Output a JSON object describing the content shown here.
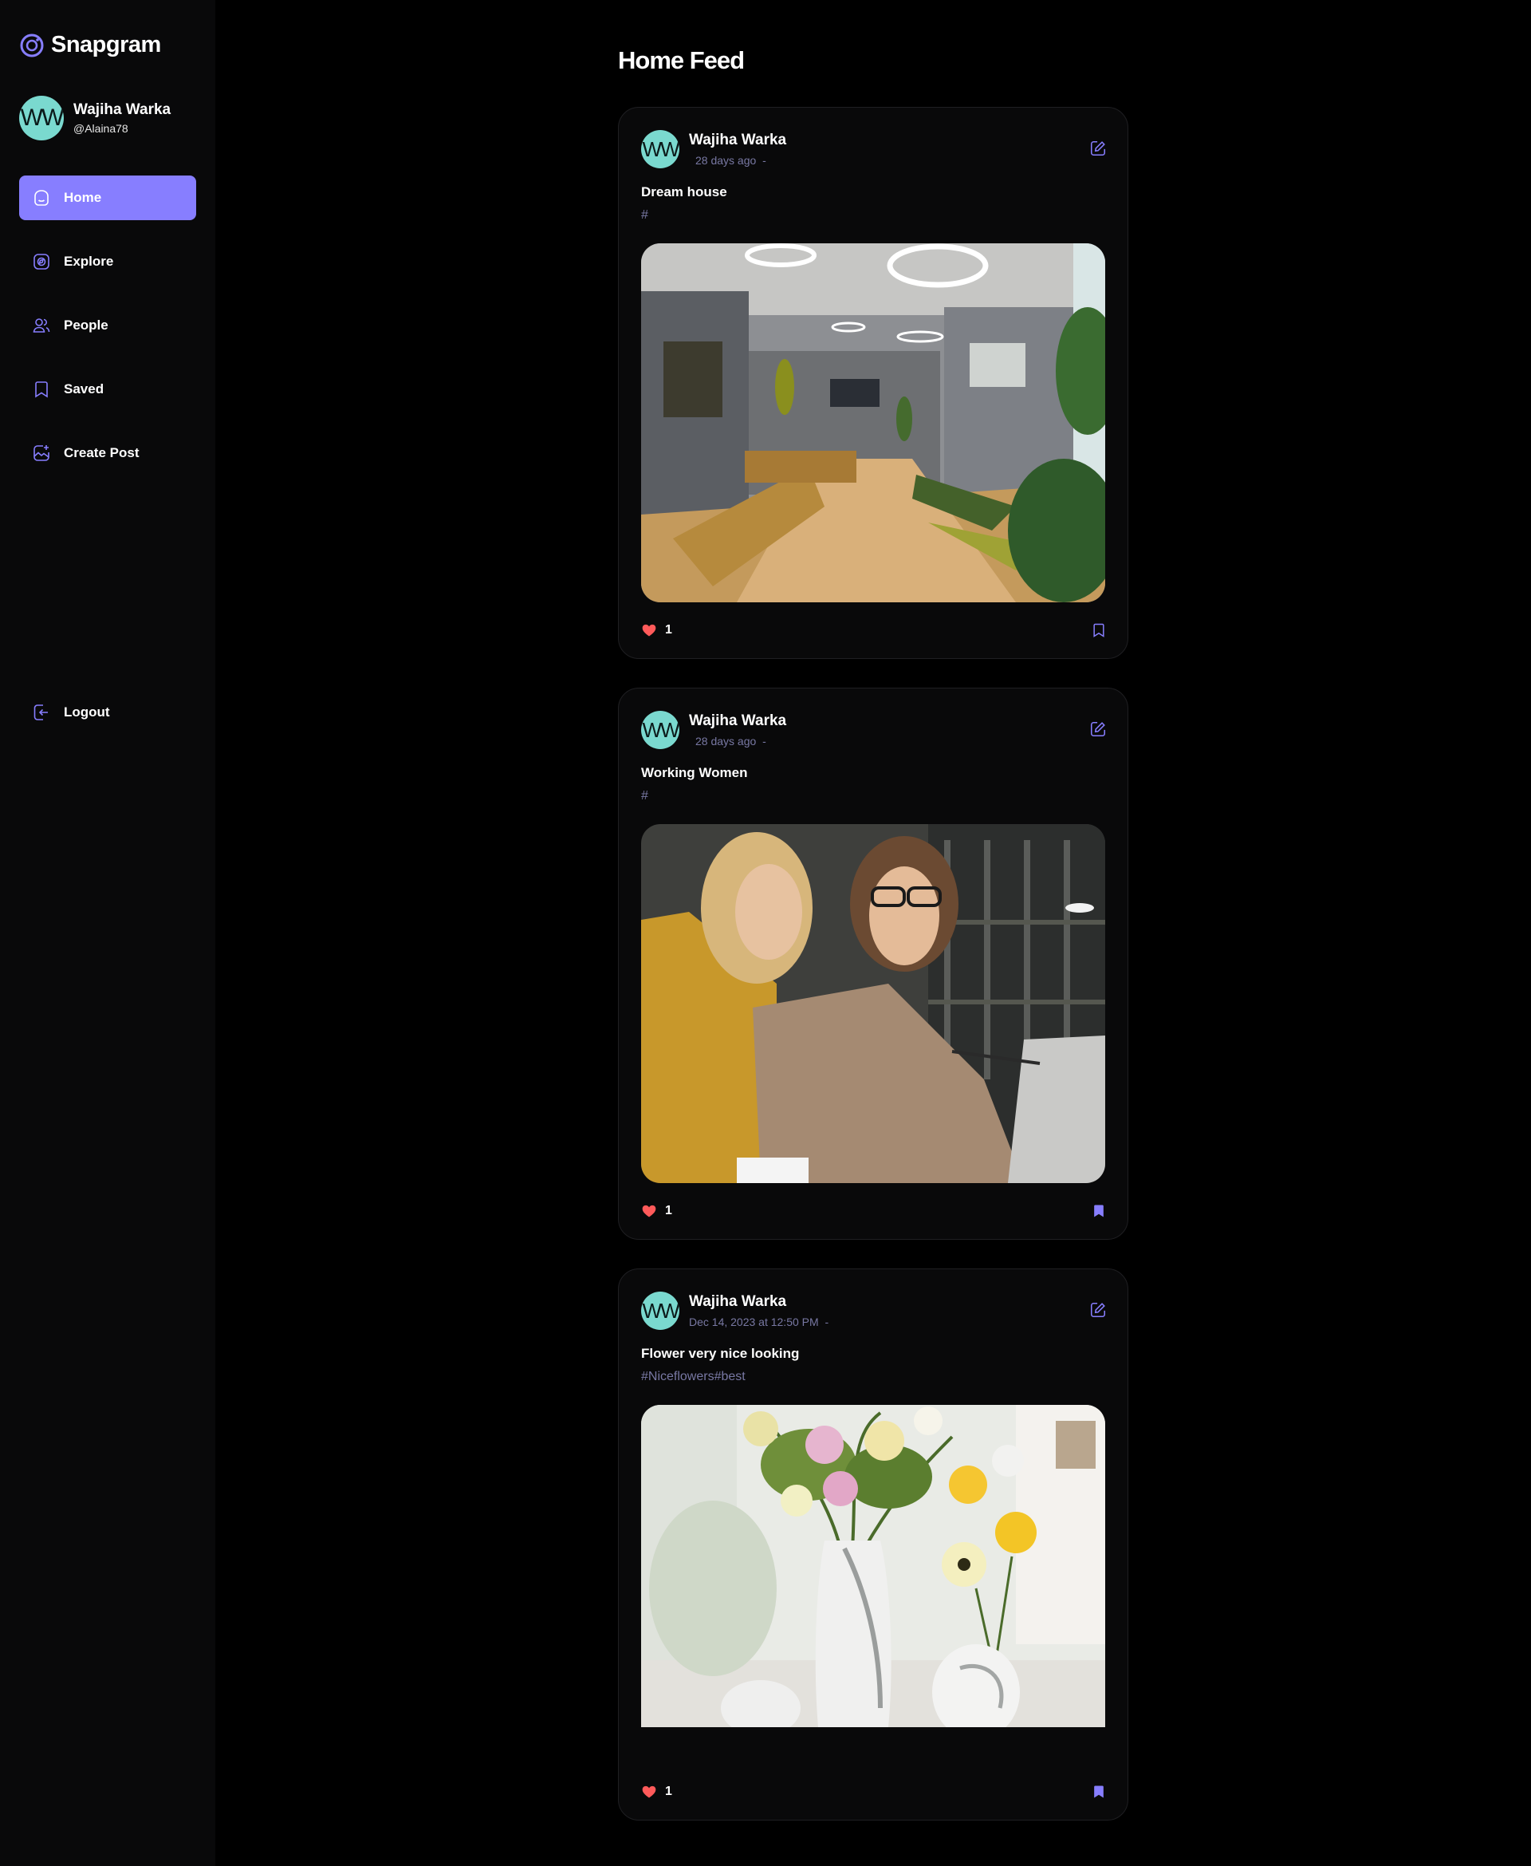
{
  "app": {
    "name": "Snapgram"
  },
  "user": {
    "initials": "WW",
    "name": "Wajiha Warka",
    "handle": "@Alaina78"
  },
  "nav": {
    "items": [
      {
        "label": "Home",
        "icon": "home-icon",
        "active": true
      },
      {
        "label": "Explore",
        "icon": "explore-icon",
        "active": false
      },
      {
        "label": "People",
        "icon": "people-icon",
        "active": false
      },
      {
        "label": "Saved",
        "icon": "bookmark-icon",
        "active": false
      },
      {
        "label": "Create Post",
        "icon": "create-post-icon",
        "active": false
      }
    ],
    "logout_label": "Logout"
  },
  "feed": {
    "title": "Home Feed",
    "posts": [
      {
        "author": "Wajiha Warka",
        "author_initials": "WW",
        "time": "28 days ago",
        "location": "-",
        "caption": "Dream house",
        "tags": "#",
        "likes": "1",
        "saved": false,
        "image": "living-room-photo"
      },
      {
        "author": "Wajiha Warka",
        "author_initials": "WW",
        "time": "28 days ago",
        "location": "-",
        "caption": "Working Women",
        "tags": "#",
        "likes": "1",
        "saved": true,
        "image": "working-women-photo"
      },
      {
        "author": "Wajiha Warka",
        "author_initials": "WW",
        "time": "Dec 14, 2023 at 12:50 PM",
        "location": "-",
        "caption": "Flower very nice looking",
        "tags": "#Niceflowers#best",
        "likes": "1",
        "saved": true,
        "image": "flowers-vase-photo"
      }
    ]
  },
  "colors": {
    "accent": "#877eff",
    "muted": "#7878a3",
    "like": "#ff5a5a",
    "avatar": "#7ad9cf"
  }
}
